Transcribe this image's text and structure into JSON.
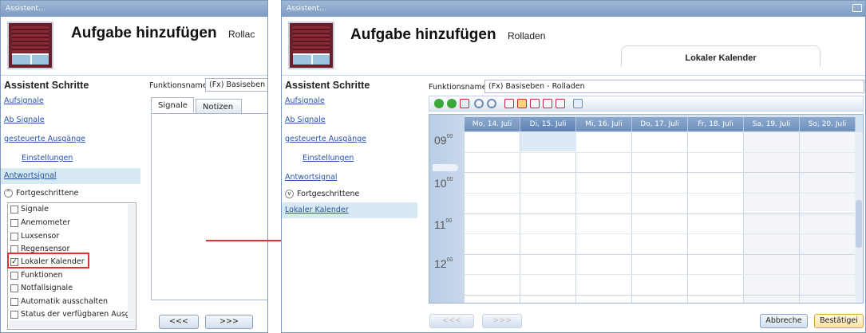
{
  "left_window": {
    "title": "Assistent...",
    "header_title": "Aufgabe hinzufügen",
    "header_subtitle": "Rollac",
    "sidebar_title": "Assistent Schritte",
    "links": [
      "Aufsignale",
      "Ab Signale",
      "gesteuerte Ausgänge",
      "Einstellungen",
      "Antwortsignal"
    ],
    "advanced_label": "Fortgeschrittene",
    "checkboxes": [
      {
        "label": "Signale",
        "checked": false
      },
      {
        "label": "Anemometer",
        "checked": false
      },
      {
        "label": "Luxsensor",
        "checked": false
      },
      {
        "label": "Regensensor",
        "checked": false
      },
      {
        "label": "Lokaler Kalender",
        "checked": true
      },
      {
        "label": "Funktionen",
        "checked": false
      },
      {
        "label": "Notfallsignale",
        "checked": false
      },
      {
        "label": "Automatik ausschalten",
        "checked": false
      },
      {
        "label": "Status der verfügbaren Ausgä",
        "checked": false
      }
    ],
    "function_label": "Funktionsname",
    "function_value": "(Fx) Basiseben -",
    "tabs": [
      "Signale",
      "Notizen"
    ],
    "buttons": {
      "back": "<<<",
      "next": ">>>"
    }
  },
  "right_window": {
    "title": "Assistent...",
    "header_title": "Aufgabe hinzufügen",
    "header_subtitle": "Rolladen",
    "calendar_tab": "Lokaler Kalender",
    "sidebar_title": "Assistent Schritte",
    "links": [
      "Aufsignale",
      "Ab Signale",
      "gesteuerte Ausgänge",
      "Einstellungen",
      "Antwortsignal"
    ],
    "advanced_label": "Fortgeschrittene",
    "active_link": "Lokaler Kalender",
    "function_label": "Funktionsname",
    "function_value": "(Fx) Basiseben - Rolladen",
    "days": [
      "Mo, 14. Juli",
      "Di, 15. Juli",
      "Mi, 16. Juli",
      "Do, 17. Juli",
      "Fr, 18. Juli",
      "Sa, 19. Juli",
      "So, 20. Juli"
    ],
    "hours": [
      {
        "h": "09",
        "m": "00"
      },
      {
        "h": "10",
        "m": "00"
      },
      {
        "h": "11",
        "m": "00"
      },
      {
        "h": "12",
        "m": "00"
      }
    ],
    "buttons": {
      "back": "<<<",
      "next": ">>>",
      "cancel": "Abbreche",
      "confirm": "Bestätigei"
    }
  },
  "colors": {
    "accent_link": "#2653a3",
    "highlight_box": "#e03030",
    "arrow": "#e03030"
  }
}
